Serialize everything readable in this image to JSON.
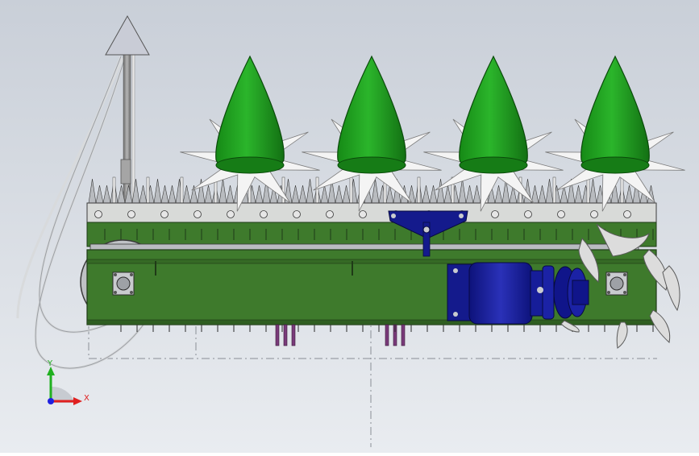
{
  "viewport": {
    "background_top": "#c9cfd8",
    "background_bottom": "#e9ecf0"
  },
  "colors": {
    "frame_green": "#3e7a2c",
    "frame_edge": "#1f3a17",
    "cone_green": "#1e9e1e",
    "star_white": "#f4f4f4",
    "motor_blue": "#141a8c",
    "rod_gray": "#8a8a8a",
    "hose_gray": "#d8dadc",
    "bolt_purple": "#7a3a7a"
  },
  "dividers": [
    {
      "name": "divider-1"
    },
    {
      "name": "divider-2"
    },
    {
      "name": "divider-3"
    },
    {
      "name": "divider-4"
    }
  ],
  "triad": {
    "x_label": "X",
    "y_label": "Y",
    "x_color": "#e02020",
    "y_color": "#20b020",
    "z_color": "#2020e0"
  }
}
